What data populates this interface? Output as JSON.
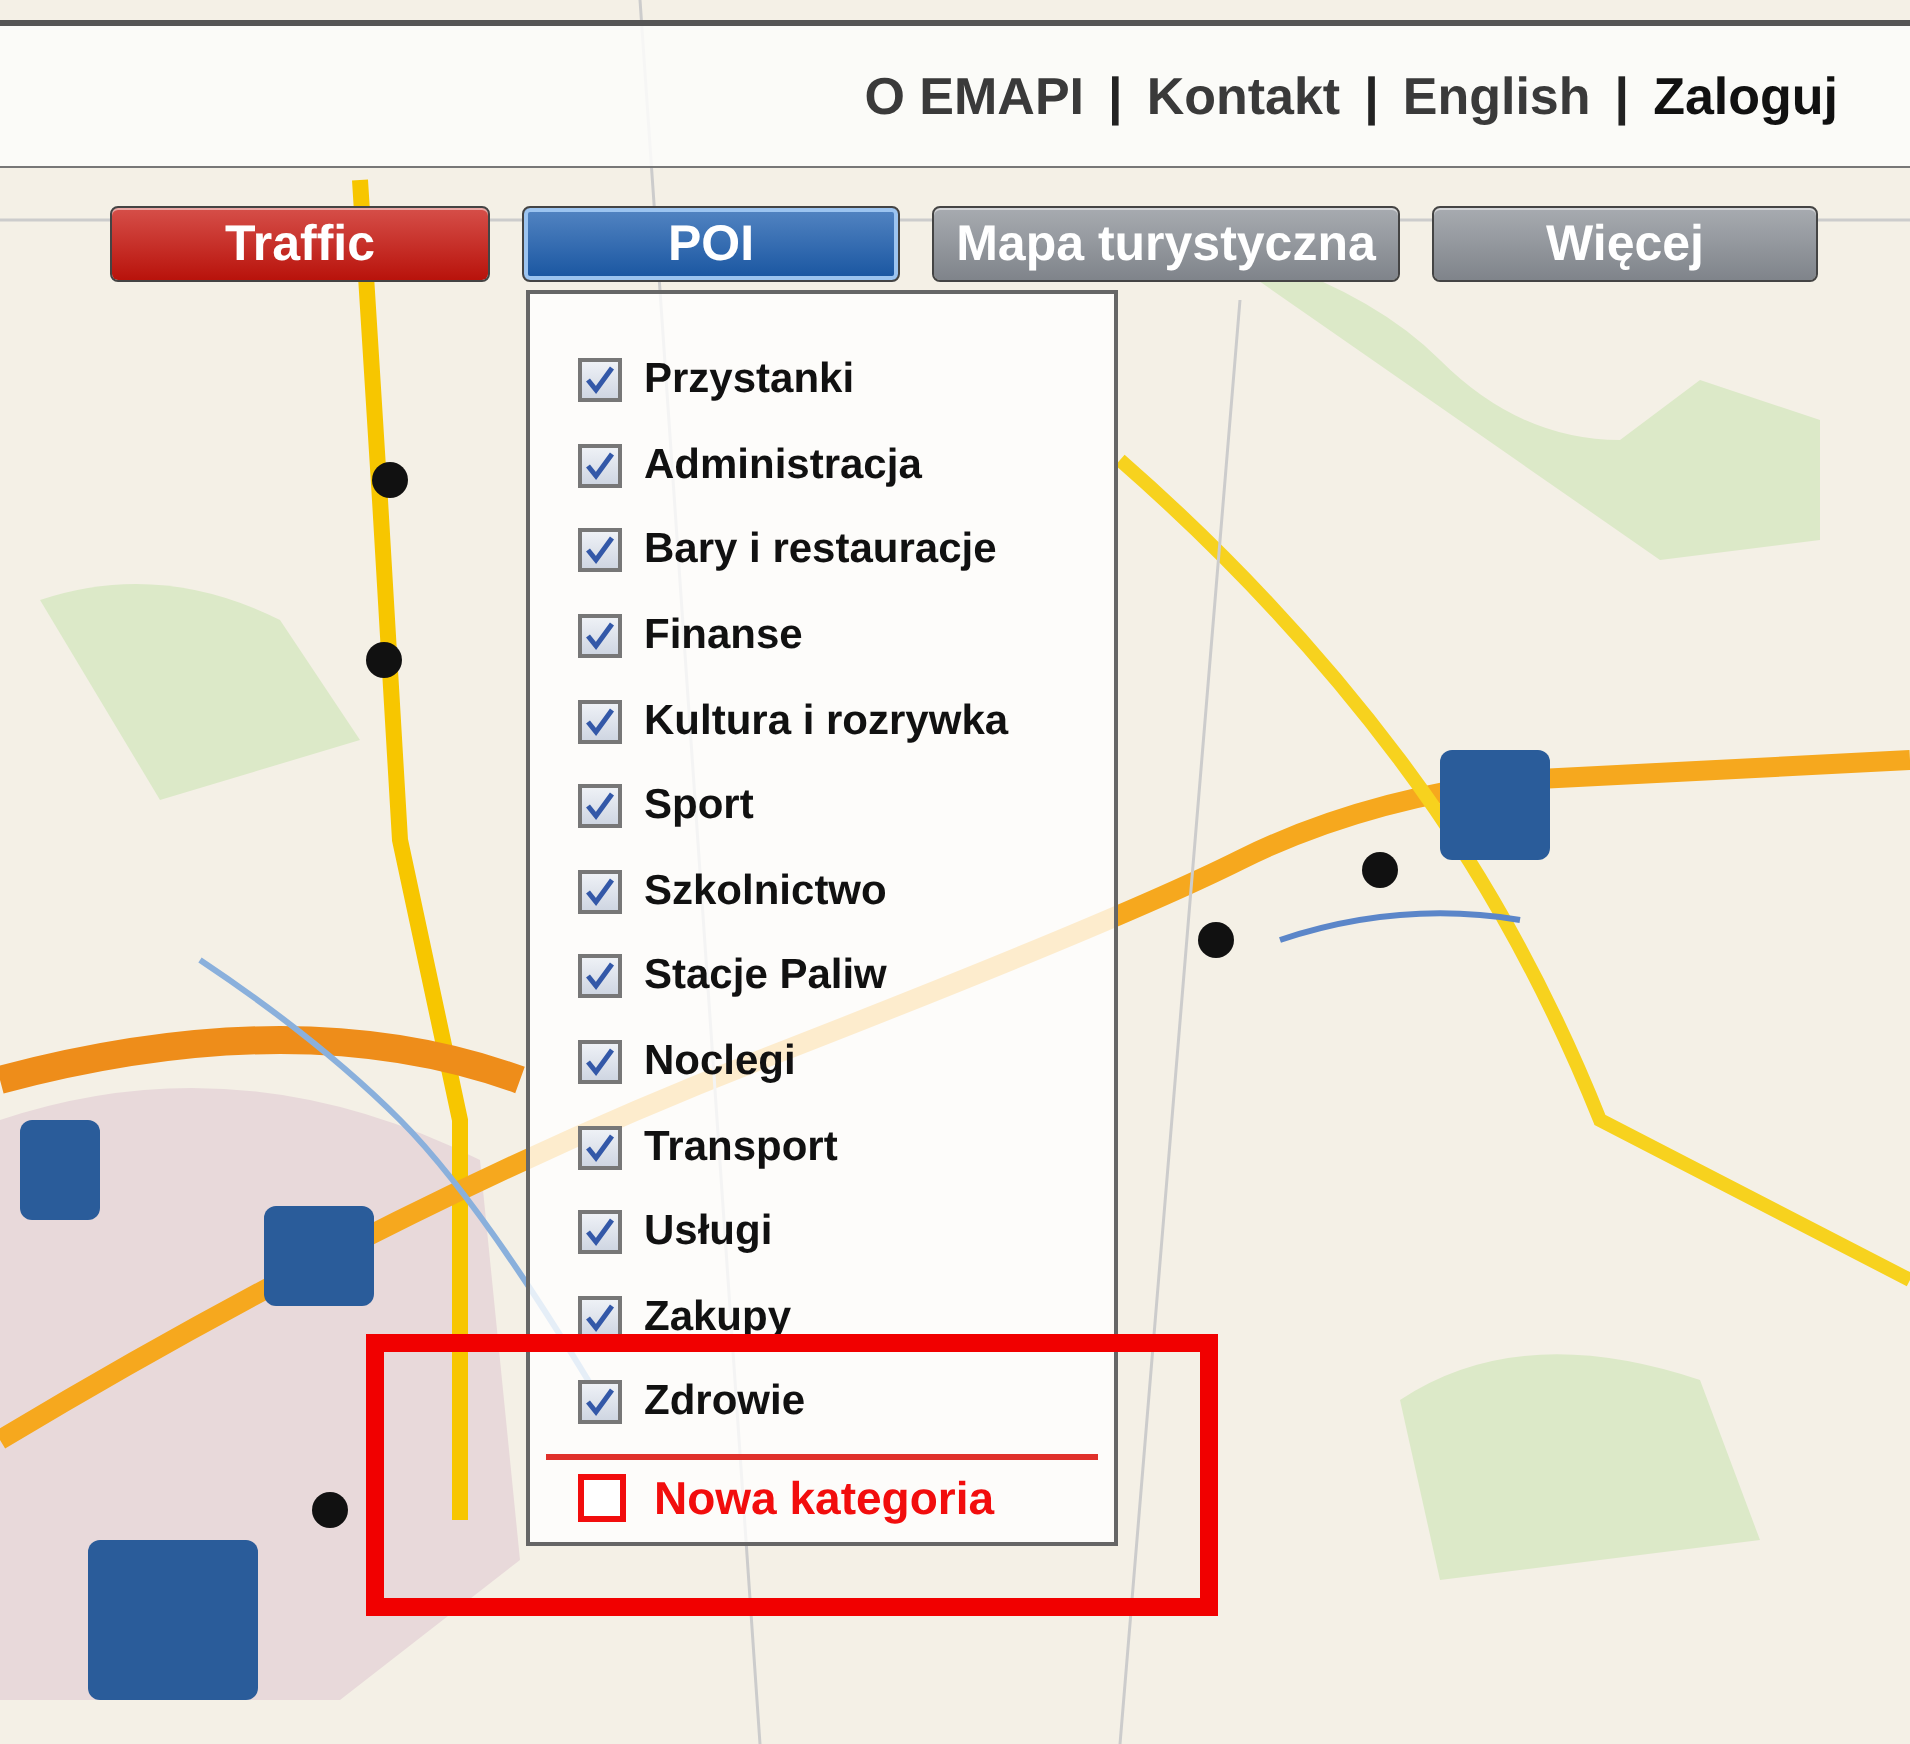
{
  "top_nav": [
    {
      "kind": "link",
      "label": "O EMAPI"
    },
    {
      "kind": "separator",
      "label": "|"
    },
    {
      "kind": "link",
      "label": "Kontakt"
    },
    {
      "kind": "separator",
      "label": "|"
    },
    {
      "kind": "link",
      "label": "English"
    },
    {
      "kind": "separator",
      "label": "|"
    },
    {
      "kind": "link",
      "label": "Zaloguj"
    }
  ],
  "layer_buttons": [
    {
      "label": "Traffic",
      "color": "#c8140c",
      "selected": false
    },
    {
      "label": "POI",
      "color": "#1a5cae",
      "selected": true
    },
    {
      "label": "Mapa turystyczna",
      "color": "#8a8f96",
      "selected": false
    },
    {
      "label": "Więcej",
      "color": "#8a8f96",
      "selected": false
    }
  ],
  "poi_categories": [
    {
      "label": "Przystanki",
      "checked": true
    },
    {
      "label": "Administracja",
      "checked": true
    },
    {
      "label": "Bary i restauracje",
      "checked": true
    },
    {
      "label": "Finanse",
      "checked": true
    },
    {
      "label": "Kultura i rozrywka",
      "checked": true
    },
    {
      "label": "Sport",
      "checked": true
    },
    {
      "label": "Szkolnictwo",
      "checked": true
    },
    {
      "label": "Stacje Paliw",
      "checked": true
    },
    {
      "label": "Noclegi",
      "checked": true
    },
    {
      "label": "Transport",
      "checked": true
    },
    {
      "label": "Usługi",
      "checked": true
    },
    {
      "label": "Zakupy",
      "checked": true
    },
    {
      "label": "Zdrowie",
      "checked": true
    }
  ],
  "new_category": {
    "label": "Nowa kategoria",
    "checked": false
  }
}
